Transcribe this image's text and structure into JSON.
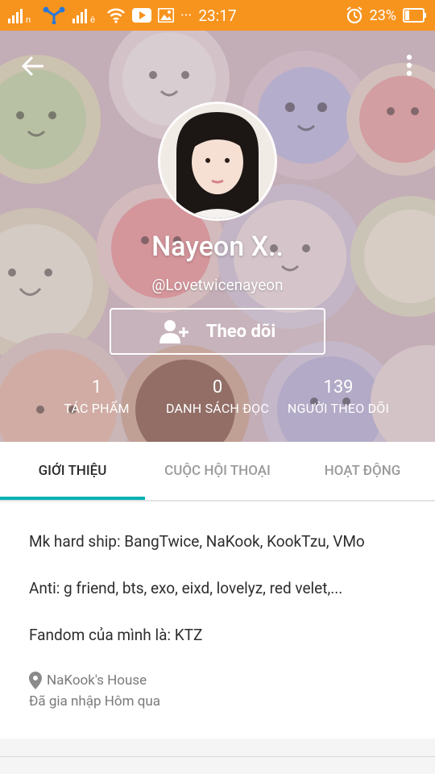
{
  "status_bar": {
    "time": "23:17",
    "battery": "23%",
    "more": "···"
  },
  "profile": {
    "name": "Nayeon X..",
    "username": "@Lovetwicenayeon",
    "follow_label": "Theo dõi"
  },
  "stats": [
    {
      "value": "1",
      "label": "TÁC PHẨM"
    },
    {
      "value": "0",
      "label": "DANH SÁCH ĐỌC"
    },
    {
      "value": "139",
      "label": "NGƯỜI THEO DÕI"
    }
  ],
  "tabs": [
    {
      "label": "GIỚI THIỆU",
      "active": true
    },
    {
      "label": "CUỘC HỘI THOẠI",
      "active": false
    },
    {
      "label": "HOẠT ĐỘNG",
      "active": false
    }
  ],
  "about": {
    "lines": [
      "Mk hard ship: BangTwice, NaKook, KookTzu, VMo",
      "Anti: g friend, bts, exo, eixd, lovelyz, red velet,...",
      "Fandom của mình là: KTZ"
    ],
    "location": "NaKook's House",
    "joined": "Đã gia nhập Hôm qua"
  },
  "colors": {
    "status_bar": "#f7941e",
    "tab_indicator": "#00b2b2"
  }
}
